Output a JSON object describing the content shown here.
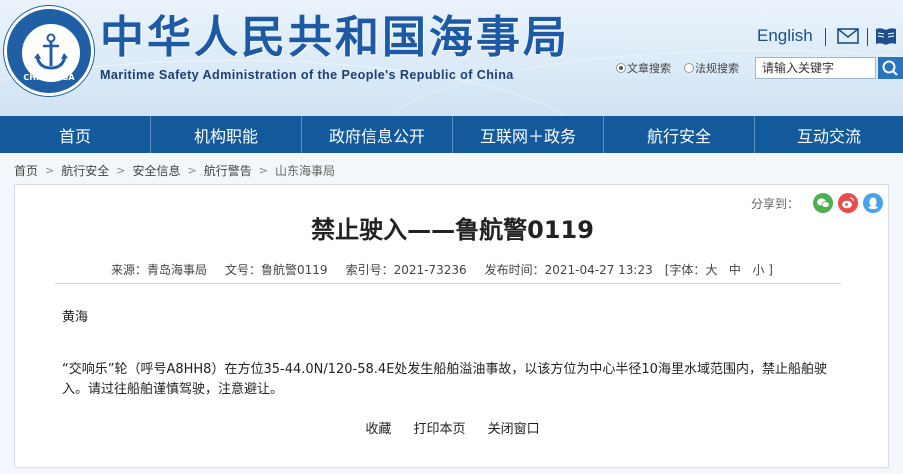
{
  "header": {
    "logo_text": "CHINA MSA",
    "title_cn": "中华人民共和国海事局",
    "title_en": "Maritime Safety Administration of the People's Republic of China",
    "english_link": "English",
    "search": {
      "options": [
        "文章搜索",
        "法规搜索"
      ],
      "selected": "文章搜索",
      "placeholder": "请输入关键字"
    }
  },
  "nav": {
    "items": [
      {
        "label": "首页"
      },
      {
        "label": "机构职能"
      },
      {
        "label": "政府信息公开"
      },
      {
        "label": "互联网＋政务"
      },
      {
        "label": "航行安全"
      },
      {
        "label": "互动交流"
      }
    ]
  },
  "breadcrumb": [
    "首页",
    "航行安全",
    "安全信息",
    "航行警告",
    "山东海事局"
  ],
  "article": {
    "share_label": "分享到：",
    "title": "禁止驶入——鲁航警0119",
    "meta": {
      "source": "来源：青岛海事局",
      "doc_no": "文号：鲁航警0119",
      "index_no": "索引号：2021-73236",
      "published": "发布时间：2021-04-27 13:23",
      "font_prefix": "[字体：",
      "font_large": "大",
      "font_medium": "中",
      "font_small": "小",
      "font_suffix": "]"
    },
    "region": "黄海",
    "body": "“交响乐”轮（呼号A8HH8）在方位35-44.0N/120-58.4E处发生船舶溢油事故，以该方位为中心半径10海里水域范围内，禁止船舶驶入。请过往船舶谨慎驾驶，注意避让。",
    "actions": {
      "favorite": "收藏",
      "print": "打印本页",
      "close": "关闭窗口"
    }
  },
  "colors": {
    "nav_bg": "#125a9c",
    "title_blue": "#1d5aa6",
    "wechat": "#4caf50",
    "weibo": "#e94b4b",
    "qq": "#4aa3e8"
  },
  "icons": [
    "anchor-icon",
    "mail-icon",
    "book-icon",
    "search-icon",
    "wechat-icon",
    "weibo-icon",
    "qq-icon"
  ]
}
